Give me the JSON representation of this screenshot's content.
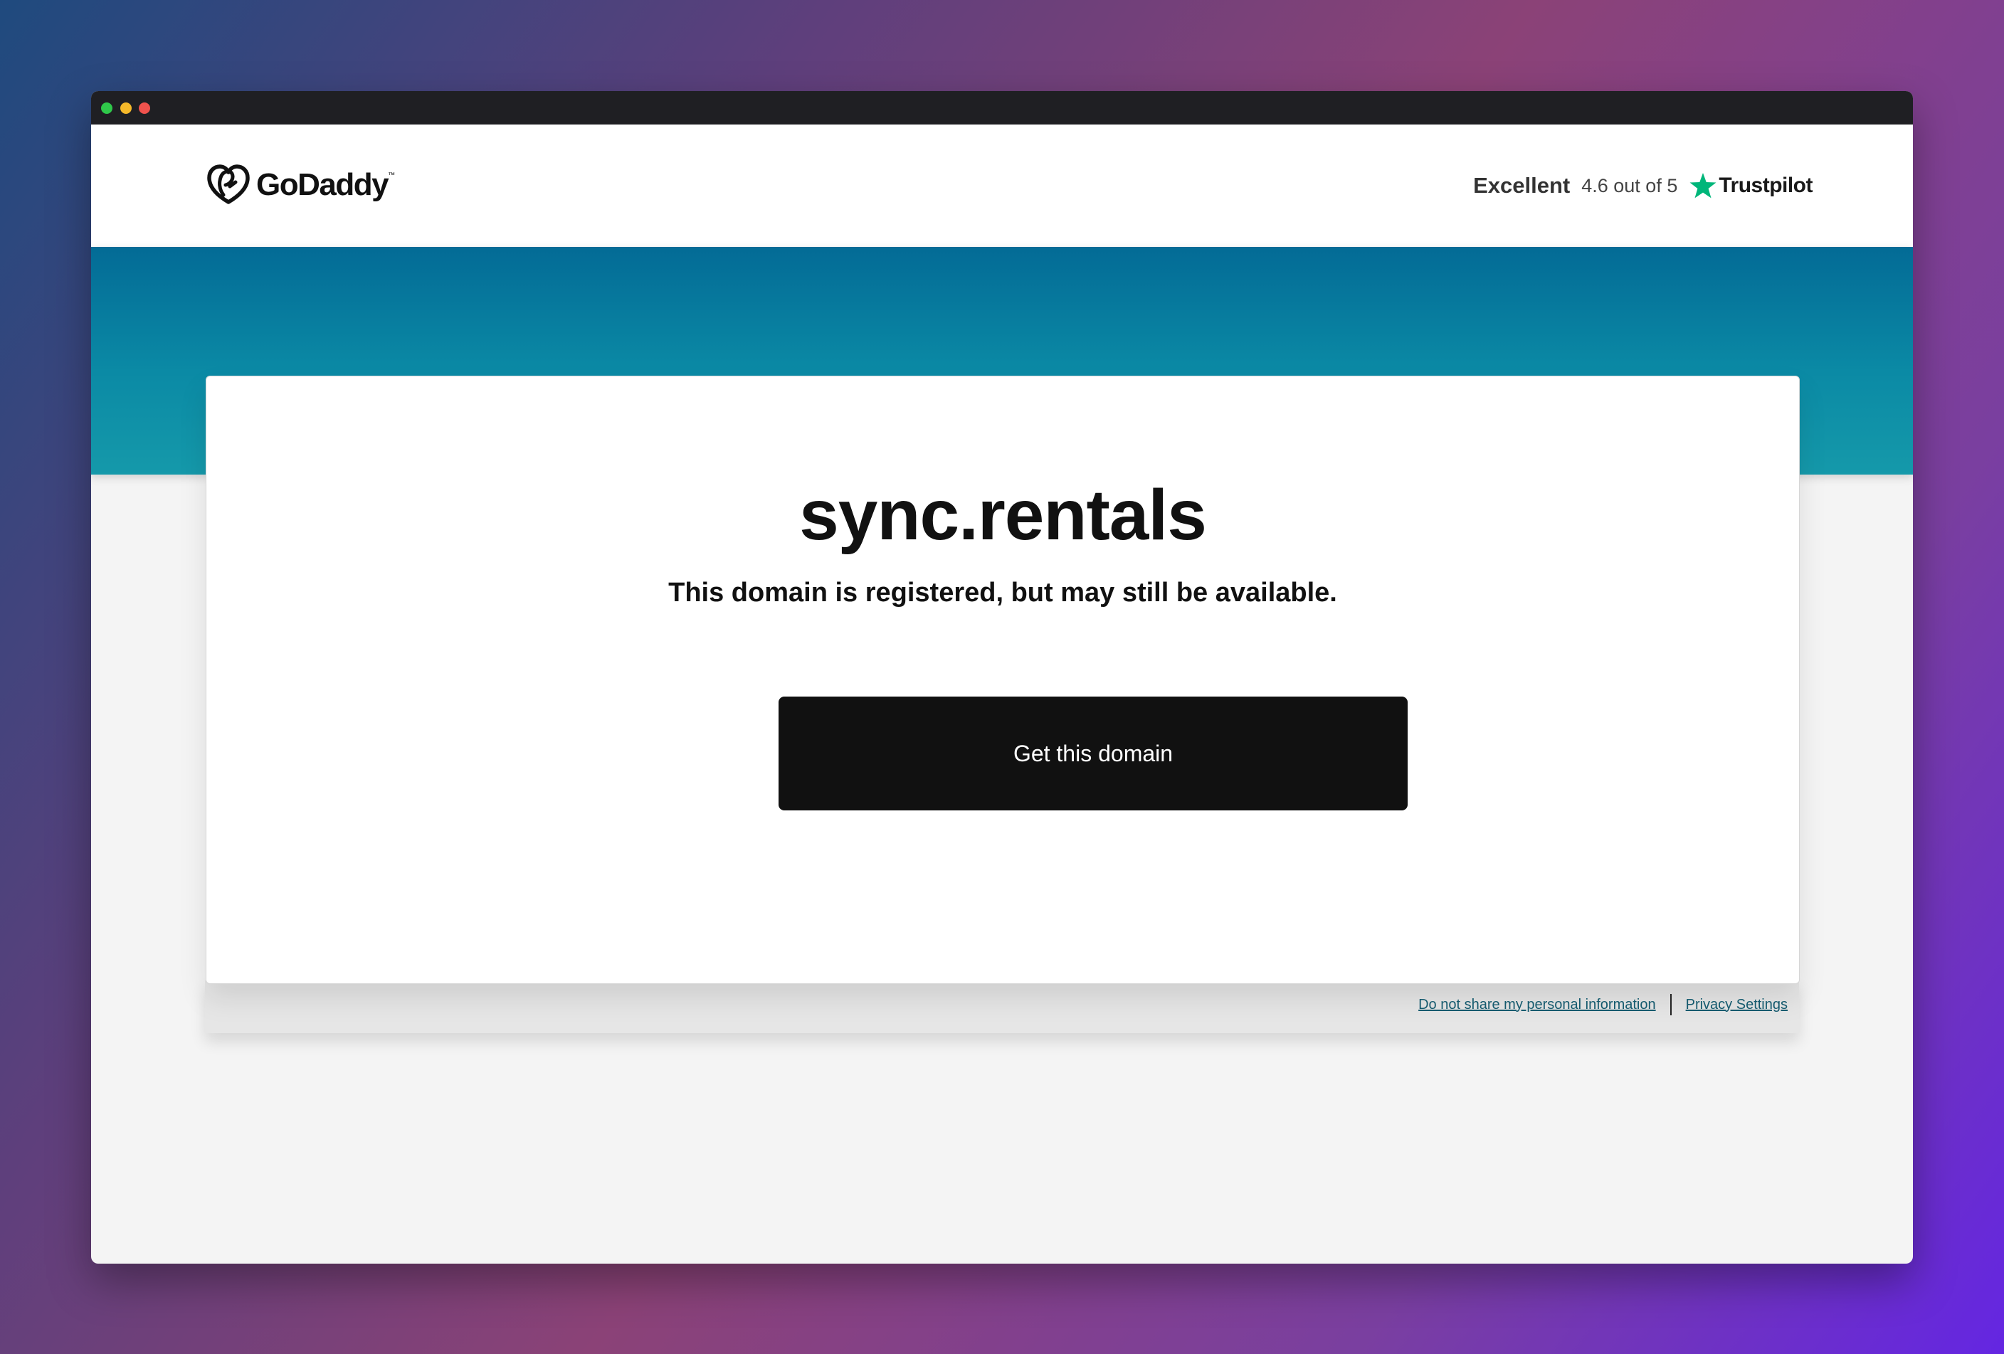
{
  "window": {
    "controls": [
      "close",
      "minimize",
      "maximize"
    ]
  },
  "header": {
    "logo_text": "GoDaddy",
    "logo_tm": "™",
    "rating": {
      "label": "Excellent",
      "score": "4.6 out of 5",
      "brand": "Trustpilot",
      "star_color": "#00b67a"
    }
  },
  "main": {
    "domain": "sync.rentals",
    "status": "This domain is registered, but may still be available.",
    "cta_label": "Get this domain"
  },
  "footer": {
    "links": [
      {
        "label": "Do not share my personal information"
      },
      {
        "label": "Privacy Settings"
      }
    ]
  },
  "colors": {
    "hero_top": "#036b96",
    "hero_bottom": "#1599aa",
    "cta_bg": "#111111",
    "link": "#155a6e"
  }
}
